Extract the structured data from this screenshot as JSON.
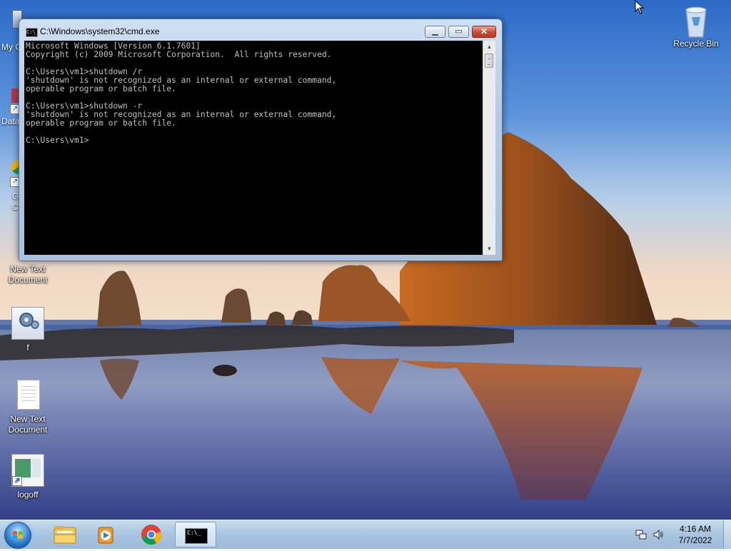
{
  "desktop": {
    "icons": [
      {
        "id": "my-computer",
        "label": "My C"
      },
      {
        "id": "data",
        "label": "Data"
      },
      {
        "id": "chrome",
        "label": "G"
      },
      {
        "id": "new-text-1",
        "label": "New Text\nDocument"
      },
      {
        "id": "f",
        "label": "f"
      },
      {
        "id": "new-text-2",
        "label": "New Text\nDocument"
      },
      {
        "id": "logoff",
        "label": "logoff"
      },
      {
        "id": "recycle-bin",
        "label": "Recycle Bin"
      }
    ],
    "recycle_bin_label": "Recycle Bin",
    "new_text_1_label": "New Text Document",
    "f_label": "f",
    "new_text_2_label": "New Text Document",
    "logoff_label": "logoff",
    "partial_my_computer": "My C",
    "partial_data": "Data",
    "partial_chrome_1": "G",
    "partial_chrome_2": "C"
  },
  "cmd": {
    "title": "C:\\Windows\\system32\\cmd.exe",
    "icon_text": "C:\\_",
    "minimize_symbol": "▁",
    "maximize_symbol": "▭",
    "close_symbol": "✕",
    "output": "Microsoft Windows [Version 6.1.7601]\nCopyright (c) 2009 Microsoft Corporation.  All rights reserved.\n\nC:\\Users\\vm1>shutdown /r\n'shutdown' is not recognized as an internal or external command,\noperable program or batch file.\n\nC:\\Users\\vm1>shutdown -r\n'shutdown' is not recognized as an internal or external command,\noperable program or batch file.\n\nC:\\Users\\vm1>"
  },
  "taskbar": {
    "buttons": [
      "windows-explorer",
      "windows-media-player",
      "google-chrome",
      "command-prompt"
    ],
    "active": "command-prompt",
    "cmd_icon_text": "C:\\_"
  },
  "tray": {
    "time": "4:16 AM",
    "date": "7/7/2022",
    "icons": [
      "network-icon",
      "speaker-icon"
    ]
  },
  "colors": {
    "console_bg": "#000000",
    "console_fg": "#c0c0c0",
    "sky_top": "#3a73c9",
    "taskbar": "#a9c4e0"
  }
}
